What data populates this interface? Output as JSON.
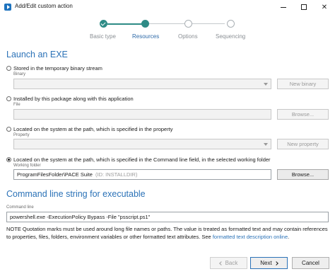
{
  "window": {
    "title": "Add/Edit custom action",
    "icon": "advanced-installer-icon"
  },
  "stepper": {
    "steps": [
      {
        "label": "Basic type",
        "state": "done"
      },
      {
        "label": "Resources",
        "state": "current"
      },
      {
        "label": "Options",
        "state": "pending"
      },
      {
        "label": "Sequencing",
        "state": "pending"
      }
    ],
    "accent_color": "#2e8b86"
  },
  "launch": {
    "title": "Launch an EXE",
    "options": [
      {
        "label": "Stored in the temporary binary stream",
        "checked": false,
        "field_label": "Binary",
        "value": "",
        "button": "New binary"
      },
      {
        "label": "Installed by this package along with this application",
        "checked": false,
        "field_label": "File",
        "value": "",
        "button": "Browse..."
      },
      {
        "label": "Located on the system at the path, which is specified in the property",
        "checked": false,
        "field_label": "Property",
        "value": "",
        "button": "New property"
      },
      {
        "label": "Located on the system at the path, which is specified in the Command line field, in the selected working folder",
        "checked": true,
        "field_label": "Working folder",
        "value": "ProgramFilesFolder\\PACE Suite",
        "value_id": "(ID: INSTALLDIR)",
        "button": "Browse..."
      }
    ]
  },
  "command_line": {
    "title": "Command line string for executable",
    "field_label": "Command line",
    "value": "powershell.exe -ExecutionPolicy Bypass -File \"psscript.ps1\"",
    "note_text": "NOTE Quotation marks must be used around long file names or paths. The value is treated as formatted text and may contain references to properties, files, folders, environment variables or other formatted text attributes. See",
    "note_link": "formatted text description online",
    "note_end": "."
  },
  "footer": {
    "back": "Back",
    "next": "Next",
    "cancel": "Cancel"
  },
  "colors": {
    "heading": "#2b72b7",
    "link": "#2b72b7"
  }
}
